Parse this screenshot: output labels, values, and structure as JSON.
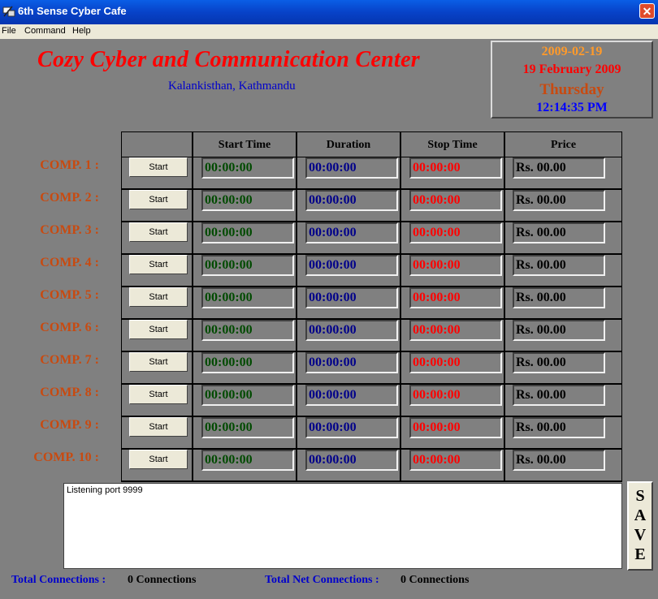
{
  "window": {
    "title": "6th Sense Cyber Cafe",
    "close_glyph": "✕"
  },
  "menu": [
    "File",
    "Command",
    "Help"
  ],
  "header": {
    "title": "Cozy Cyber and Communication Center",
    "subtitle": "Kalankisthan, Kathmandu"
  },
  "datetime": {
    "date_iso": "2009-02-19",
    "date_long": "19 February 2009",
    "weekday": "Thursday",
    "time": "12:14:35 PM"
  },
  "columns": [
    "Start Time",
    "Duration",
    "Stop Time",
    "Price"
  ],
  "rows": [
    {
      "label": "COMP. 1 :",
      "button": "Start",
      "start": "00:00:00",
      "duration": "00:00:00",
      "stop": "00:00:00",
      "price": "Rs. 00.00"
    },
    {
      "label": "COMP. 2 :",
      "button": "Start",
      "start": "00:00:00",
      "duration": "00:00:00",
      "stop": "00:00:00",
      "price": "Rs. 00.00"
    },
    {
      "label": "COMP. 3 :",
      "button": "Start",
      "start": "00:00:00",
      "duration": "00:00:00",
      "stop": "00:00:00",
      "price": "Rs. 00.00"
    },
    {
      "label": "COMP. 4 :",
      "button": "Start",
      "start": "00:00:00",
      "duration": "00:00:00",
      "stop": "00:00:00",
      "price": "Rs. 00.00"
    },
    {
      "label": "COMP. 5 :",
      "button": "Start",
      "start": "00:00:00",
      "duration": "00:00:00",
      "stop": "00:00:00",
      "price": "Rs. 00.00"
    },
    {
      "label": "COMP. 6 :",
      "button": "Start",
      "start": "00:00:00",
      "duration": "00:00:00",
      "stop": "00:00:00",
      "price": "Rs. 00.00"
    },
    {
      "label": "COMP. 7 :",
      "button": "Start",
      "start": "00:00:00",
      "duration": "00:00:00",
      "stop": "00:00:00",
      "price": "Rs. 00.00"
    },
    {
      "label": "COMP. 8 :",
      "button": "Start",
      "start": "00:00:00",
      "duration": "00:00:00",
      "stop": "00:00:00",
      "price": "Rs. 00.00"
    },
    {
      "label": "COMP. 9 :",
      "button": "Start",
      "start": "00:00:00",
      "duration": "00:00:00",
      "stop": "00:00:00",
      "price": "Rs. 00.00"
    },
    {
      "label": "COMP. 10 :",
      "button": "Start",
      "start": "00:00:00",
      "duration": "00:00:00",
      "stop": "00:00:00",
      "price": "Rs. 00.00"
    }
  ],
  "log": {
    "text": "Listening port 9999"
  },
  "save_button": {
    "letters": [
      "S",
      "A",
      "V",
      "E"
    ]
  },
  "footer": {
    "total_label": "Total Connections :",
    "total_value": "0 Connections",
    "net_label": "Total Net Connections :",
    "net_value": "0 Connections"
  },
  "colors": {
    "title_red": "#ff0000",
    "subtitle_blue": "#0000cc",
    "comp_label": "#c84a10",
    "start_green": "#004a00",
    "duration_navy": "#00008a",
    "stop_red": "#ff0000"
  }
}
